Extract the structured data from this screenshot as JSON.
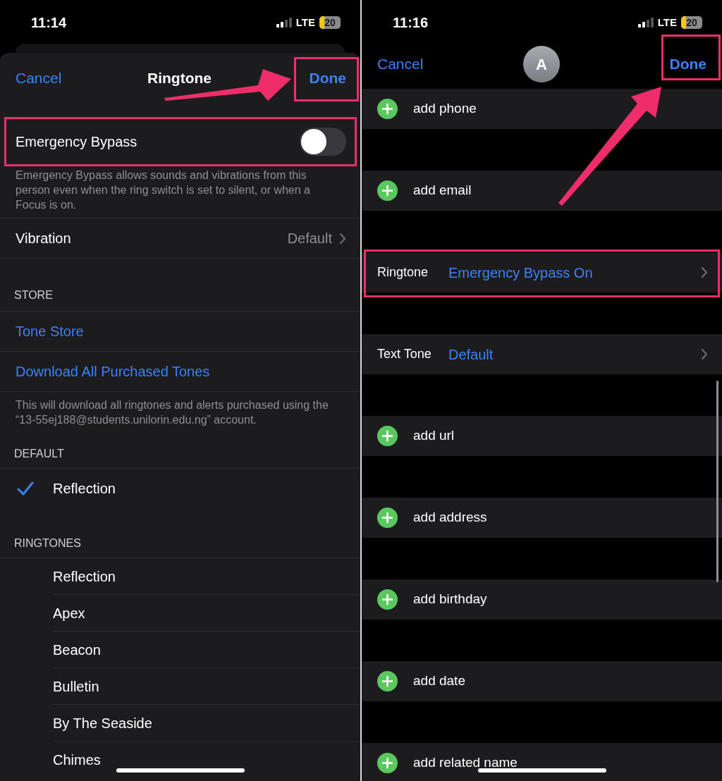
{
  "left": {
    "status_bar": {
      "time": "11:14",
      "network": "LTE",
      "battery": "20"
    },
    "nav": {
      "cancel": "Cancel",
      "title": "Ringtone",
      "done": "Done",
      "done_highlighted": true
    },
    "emergency_bypass": {
      "label": "Emergency Bypass",
      "on": false,
      "highlighted": true
    },
    "emergency_note": "Emergency Bypass allows sounds and vibrations from this person even when the ring switch is set to silent, or when a Focus is on.",
    "vibration": {
      "label": "Vibration",
      "value": "Default"
    },
    "sections": [
      {
        "header": "STORE",
        "items": [
          {
            "kind": "link",
            "label": "Tone Store"
          },
          {
            "kind": "link",
            "label": "Download All Purchased Tones"
          }
        ],
        "footer": "This will download all ringtones and alerts purchased using the “13-55ej188@students.unilorin.edu.ng” account."
      },
      {
        "header": "DEFAULT",
        "items": [
          {
            "kind": "tone",
            "label": "Reflection",
            "checked": true
          }
        ]
      },
      {
        "header": "RINGTONES",
        "items": [
          {
            "kind": "tone",
            "label": "Reflection",
            "checked": false
          },
          {
            "kind": "tone",
            "label": "Apex",
            "checked": false
          },
          {
            "kind": "tone",
            "label": "Beacon",
            "checked": false
          },
          {
            "kind": "tone",
            "label": "Bulletin",
            "checked": false
          },
          {
            "kind": "tone",
            "label": "By The Seaside",
            "checked": false
          },
          {
            "kind": "tone",
            "label": "Chimes",
            "checked": false
          }
        ]
      }
    ]
  },
  "right": {
    "status_bar": {
      "time": "11:16",
      "network": "LTE",
      "battery": "20"
    },
    "nav": {
      "cancel": "Cancel",
      "avatar": "A",
      "done": "Done",
      "done_highlighted": true
    },
    "rows": [
      {
        "kind": "add",
        "label": "add phone"
      },
      {
        "kind": "add",
        "label": "add email"
      },
      {
        "kind": "detail",
        "label": "Ringtone",
        "value": "Emergency Bypass On",
        "highlighted": true
      },
      {
        "kind": "detail",
        "label": "Text Tone",
        "value": "Default",
        "highlighted": false
      },
      {
        "kind": "add",
        "label": "add url"
      },
      {
        "kind": "add",
        "label": "add address"
      },
      {
        "kind": "add",
        "label": "add birthday"
      },
      {
        "kind": "add",
        "label": "add date"
      },
      {
        "kind": "add",
        "label": "add related name"
      }
    ]
  }
}
